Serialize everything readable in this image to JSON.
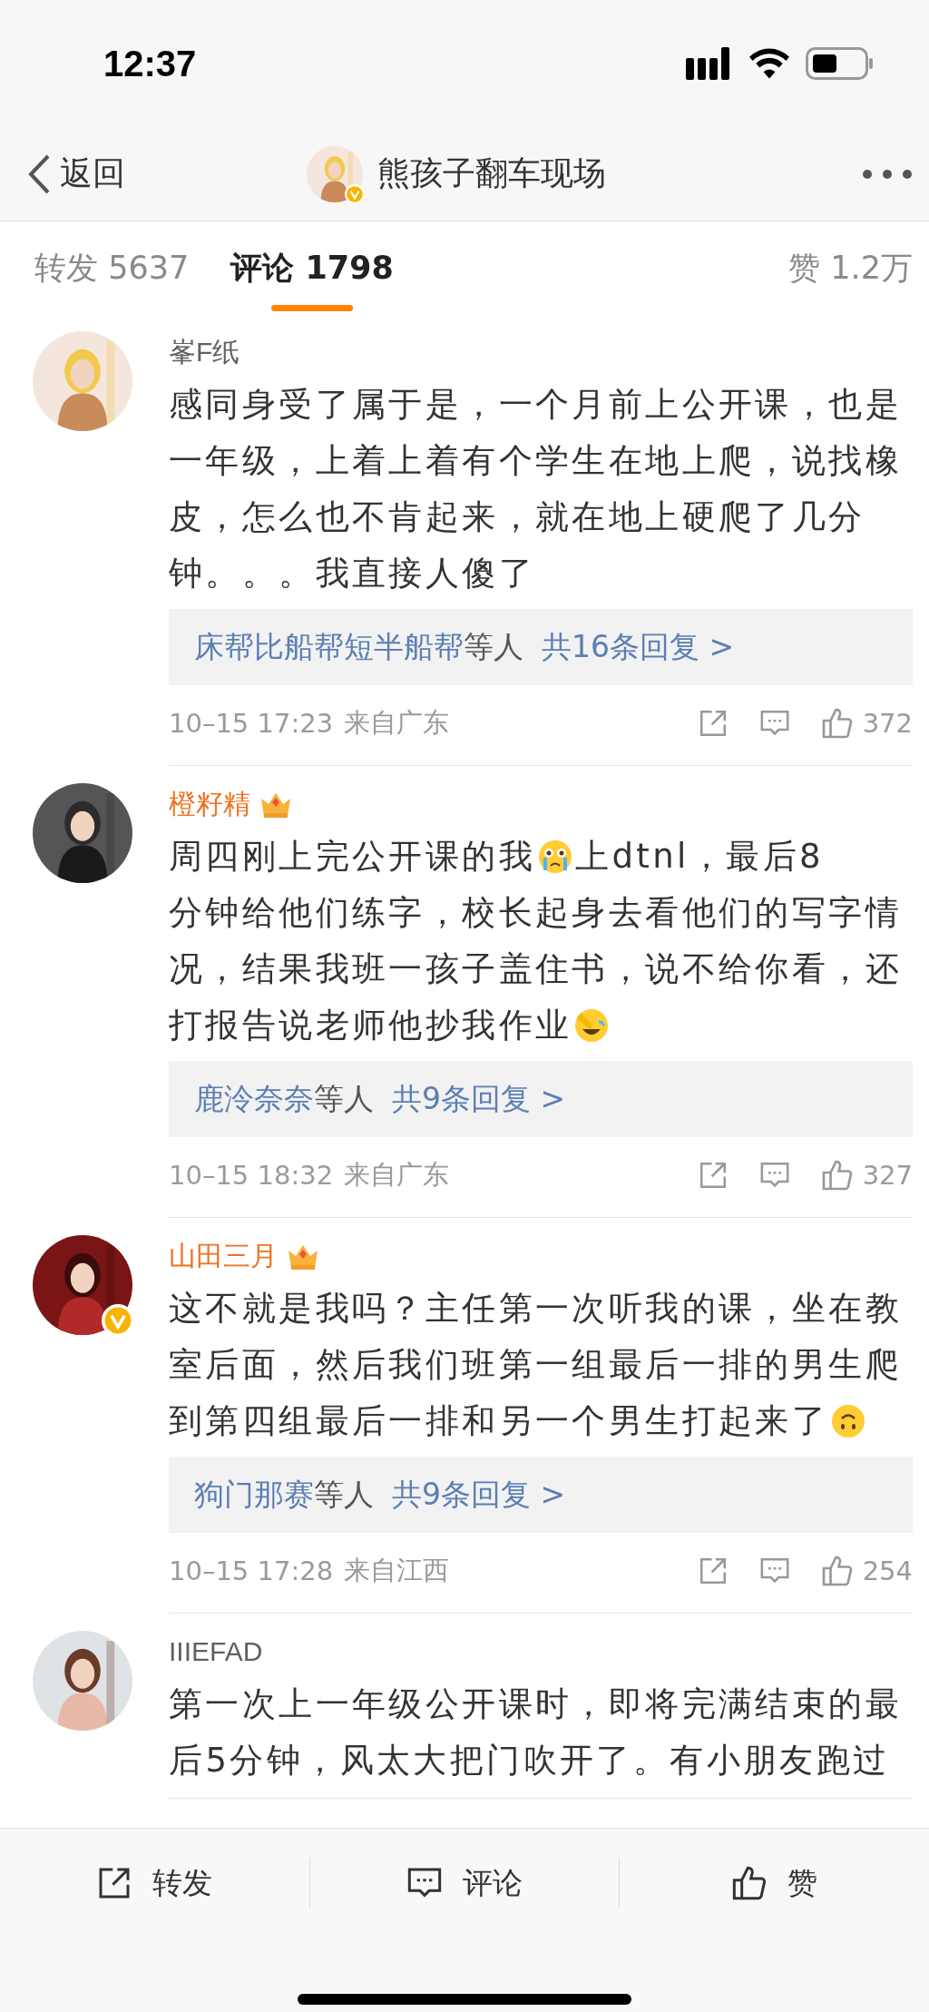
{
  "status_bar": {
    "time": "12:37"
  },
  "nav": {
    "back": "返回",
    "title": "熊孩子翻车现场",
    "verified": true
  },
  "tabs": [
    {
      "label": "转发 5637",
      "selected": false
    },
    {
      "label": "评论 1798",
      "selected": true
    }
  ],
  "likes_tab": {
    "label": "赞 1.2万"
  },
  "comments": [
    {
      "name": "峯F纸",
      "member_badge": false,
      "verified": false,
      "avatar": {
        "kind": "picture"
      },
      "lines": [
        [
          {
            "kind": "text",
            "text": "感同身受了属于是，一个月前上公开课，也是"
          }
        ],
        [
          {
            "kind": "text",
            "text": "一年级，上着上着有个学生在地上爬，说找橡"
          }
        ],
        [
          {
            "kind": "text",
            "text": "皮，怎么也不肯起来，就在地上硬爬了几分"
          }
        ],
        [
          {
            "kind": "text",
            "text": "钟。。。我直接人傻了"
          }
        ]
      ],
      "replies": {
        "names": "床帮比船帮短半船帮",
        "suffix": "等人",
        "count": "共16条回复 >"
      },
      "time": "10–15 17:23",
      "location": "来自广东",
      "likes": "372"
    },
    {
      "name": "橙籽精",
      "member_badge": true,
      "verified": false,
      "avatar": {
        "kind": "picture"
      },
      "lines": [
        [
          {
            "kind": "text",
            "text": "周四刚上完公开课的我"
          },
          {
            "kind": "crying_emoji"
          },
          {
            "kind": "text",
            "text": "上dtnl，最后8"
          }
        ],
        [
          {
            "kind": "text",
            "text": "分钟给他们练字，校长起身去看他们的写字情"
          }
        ],
        [
          {
            "kind": "text",
            "text": "况，结果我班一孩子盖住书，说不给你看，还"
          }
        ],
        [
          {
            "kind": "text",
            "text": "打报告说老师他抄我作业"
          },
          {
            "kind": "laughing_emoji"
          }
        ]
      ],
      "replies": {
        "names": "鹿泠奈奈",
        "suffix": "等人",
        "count": "共9条回复 >"
      },
      "time": "10–15 18:32",
      "location": "来自广东",
      "likes": "327"
    },
    {
      "name": "山田三月",
      "member_badge": true,
      "verified": true,
      "avatar": {
        "kind": "picture"
      },
      "lines": [
        [
          {
            "kind": "text",
            "text": "这不就是我吗？主任第一次听我的课，坐在教"
          }
        ],
        [
          {
            "kind": "text",
            "text": "室后面，然后我们班第一组最后一排的男生爬"
          }
        ],
        [
          {
            "kind": "text",
            "text": "到第四组最后一排和另一个男生打起来了"
          },
          {
            "kind": "upside_down_emoji"
          }
        ]
      ],
      "replies": {
        "names": "狗门那赛",
        "suffix": "等人",
        "count": "共9条回复 >"
      },
      "time": "10–15 17:28",
      "location": "来自江西",
      "likes": "254"
    },
    {
      "name": "IIIEFAD",
      "member_badge": false,
      "verified": false,
      "avatar": {
        "kind": "picture"
      },
      "lines": [
        [
          {
            "kind": "text",
            "text": "第一次上一年级公开课时，即将完满结束的最"
          }
        ],
        [
          {
            "kind": "text",
            "text": "后5分钟，风太大把门吹开了。有小朋友跑过"
          }
        ]
      ]
    }
  ],
  "bottom_bar": [
    {
      "kind": "share",
      "label": "转发"
    },
    {
      "kind": "comment",
      "label": "评论"
    },
    {
      "kind": "like",
      "label": "赞"
    }
  ]
}
